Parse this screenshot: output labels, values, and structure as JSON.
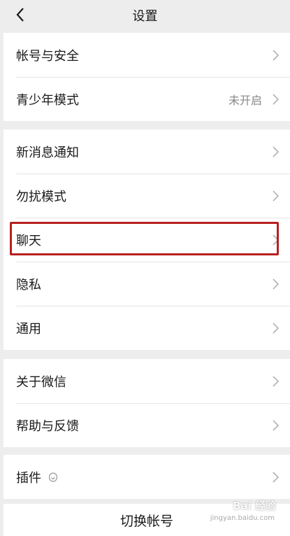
{
  "header": {
    "title": "设置"
  },
  "groups": [
    {
      "items": [
        {
          "label": "帐号与安全"
        },
        {
          "label": "青少年模式",
          "value": "未开启"
        }
      ]
    },
    {
      "items": [
        {
          "label": "新消息通知"
        },
        {
          "label": "勿扰模式"
        },
        {
          "label": "聊天"
        },
        {
          "label": "隐私"
        },
        {
          "label": "通用"
        }
      ]
    },
    {
      "items": [
        {
          "label": "关于微信"
        },
        {
          "label": "帮助与反馈"
        }
      ]
    },
    {
      "items": [
        {
          "label": "插件",
          "icon": "plugin-icon"
        }
      ]
    }
  ],
  "footer": {
    "switch_account_label": "切换帐号"
  },
  "watermark": {
    "brand": "Bai 经验",
    "url": "jingyan.baidu.com"
  },
  "colors": {
    "highlight": "#b81f1f",
    "background": "#ededed",
    "row_bg": "#ffffff",
    "secondary_text": "#8a8a8a"
  }
}
